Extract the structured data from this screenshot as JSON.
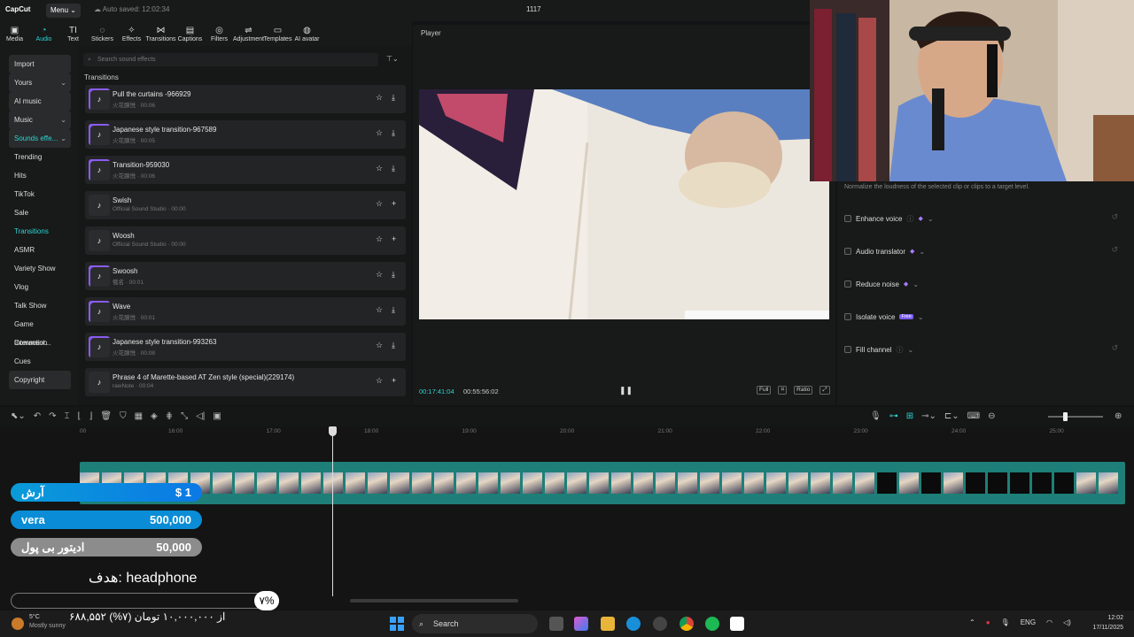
{
  "app": {
    "logo": "CapCut",
    "menu_label": "Menu",
    "autosave": "Auto saved: 12:02:34",
    "project_title": "1117"
  },
  "toolbar": [
    {
      "label": "Media",
      "icon": "media-icon",
      "glyph": "▣"
    },
    {
      "label": "Audio",
      "icon": "audio-icon",
      "glyph": "◔"
    },
    {
      "label": "Text",
      "icon": "text-icon",
      "glyph": "TI"
    },
    {
      "label": "Stickers",
      "icon": "stickers-icon",
      "glyph": "◌"
    },
    {
      "label": "Effects",
      "icon": "effects-icon",
      "glyph": "✧"
    },
    {
      "label": "Transitions",
      "icon": "transitions-icon",
      "glyph": "⋈"
    },
    {
      "label": "Captions",
      "icon": "captions-icon",
      "glyph": "▤"
    },
    {
      "label": "Filters",
      "icon": "filters-icon",
      "glyph": "◎"
    },
    {
      "label": "Adjustment",
      "icon": "adjustment-icon",
      "glyph": "⇌"
    },
    {
      "label": "Templates",
      "icon": "templates-icon",
      "glyph": "▭"
    },
    {
      "label": "AI avatar",
      "icon": "ai-avatar-icon",
      "glyph": "◍"
    }
  ],
  "sidebar": [
    {
      "label": "Import",
      "style": "boxed"
    },
    {
      "label": "Yours",
      "style": "boxed",
      "caret": true
    },
    {
      "label": "AI music",
      "style": "boxed"
    },
    {
      "label": "Music",
      "style": "boxed",
      "caret": true
    },
    {
      "label": "Sounds effe...",
      "style": "boxed cyan",
      "caret": true
    },
    {
      "label": "Trending",
      "style": ""
    },
    {
      "label": "Hits",
      "style": ""
    },
    {
      "label": "TikTok",
      "style": ""
    },
    {
      "label": "Sale",
      "style": ""
    },
    {
      "label": "Transitions",
      "style": "cyan"
    },
    {
      "label": "ASMR",
      "style": ""
    },
    {
      "label": "Variety Show",
      "style": ""
    },
    {
      "label": "Vlog",
      "style": ""
    },
    {
      "label": "Talk Show",
      "style": ""
    },
    {
      "label": "Game Comment...",
      "style": ""
    },
    {
      "label": "Interaction",
      "style": ""
    },
    {
      "label": "Cues",
      "style": ""
    },
    {
      "label": "Copyright",
      "style": "boxed"
    }
  ],
  "search": {
    "placeholder": "Search sound effects"
  },
  "section_title": "Transitions",
  "sounds": [
    {
      "name": "Pull the curtains -966929",
      "sub": "火花腺悦 · 00:06",
      "action": "⤓",
      "purple": true
    },
    {
      "name": "Japanese style transition-967589",
      "sub": "火花腺悦 · 00:05",
      "action": "⤓",
      "purple": true
    },
    {
      "name": "Transition-959030",
      "sub": "火花腺悦 · 00:06",
      "action": "⤓",
      "purple": true
    },
    {
      "name": "Swish",
      "sub": "Official Sound Studio · 00:00",
      "action": "+",
      "purple": false
    },
    {
      "name": "Woosh",
      "sub": "Official Sound Studio · 00:00",
      "action": "+",
      "purple": false
    },
    {
      "name": "Swoosh",
      "sub": "俄名 · 00:01",
      "action": "⤓",
      "purple": true
    },
    {
      "name": "Wave",
      "sub": "火花腺悦 · 00:01",
      "action": "⤓",
      "purple": true
    },
    {
      "name": "Japanese style transition-993263",
      "sub": "火花腺悦 · 00:08",
      "action": "⤓",
      "purple": true
    },
    {
      "name": "Phrase 4 of Marette-based AT Zen style (special)(229174)",
      "sub": "rawNote · 00:04",
      "action": "+",
      "purple": false
    }
  ],
  "player": {
    "label": "Player",
    "current_time": "00:17:41:04",
    "total_time": "00:55:56:02",
    "controls": [
      "Full",
      "⌗",
      "Ratio",
      "⤢"
    ]
  },
  "audio_panel": {
    "normalize_desc": "Normalize the loudness of the selected clip or clips to a target level.",
    "options": [
      {
        "label": "Enhance voice",
        "gem": true,
        "info": true,
        "reset": true
      },
      {
        "label": "Audio translator",
        "gem": true,
        "info": false,
        "reset": true
      },
      {
        "label": "Reduce noise",
        "gem": true,
        "info": false,
        "reset": false
      },
      {
        "label": "Isolate voice",
        "free": "Free",
        "reset": false
      },
      {
        "label": "Fill channel",
        "gem": false,
        "info": true,
        "reset": true
      }
    ]
  },
  "timeline": {
    "ticks": [
      "00",
      "16:00",
      "17:00",
      "18:00",
      "19:00",
      "20:00",
      "21:00",
      "22:00",
      "23:00",
      "24:00",
      "25:00"
    ]
  },
  "overlay": {
    "donors": [
      {
        "name": "آرش",
        "amount": "$ 1",
        "rank": "top"
      },
      {
        "name": "vera",
        "amount": "500,000",
        "rank": "second"
      },
      {
        "name": "ادیتور بی پول",
        "amount": "50,000",
        "rank": "third"
      }
    ],
    "goal_label": "هدف: headphone",
    "goal_percent": "۷%",
    "goal_percent_value": 7,
    "goal_amount": "۶۸۸,۵۵۲ از ۱۰,۰۰۰,۰۰۰ تومان (۷%)"
  },
  "taskbar": {
    "temp": "5°C",
    "condition": "Mostly sunny",
    "search": "Search",
    "lang": "ENG",
    "time": "12:02",
    "date": "17/11/2025"
  }
}
